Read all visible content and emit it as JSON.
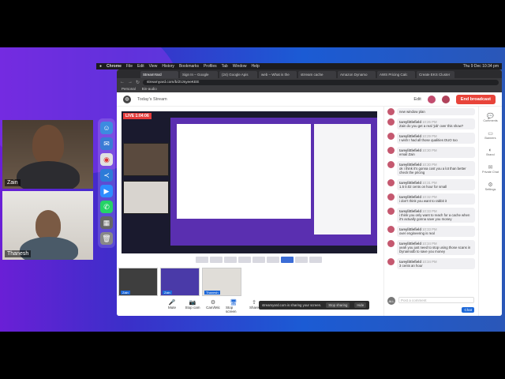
{
  "cams": [
    {
      "name": "Zain"
    },
    {
      "name": "Thanesh"
    }
  ],
  "menubar": {
    "apple": "",
    "items": [
      "Chrome",
      "File",
      "Edit",
      "View",
      "History",
      "Bookmarks",
      "Profiles",
      "Tab",
      "Window",
      "Help"
    ],
    "clock": "Thu 9 Dec 10:34 pm"
  },
  "browser": {
    "tabs": [
      "StreamYard",
      "Sign In – Google",
      "(24) Google Apis",
      "web – What is the",
      "strream cache",
      "Amazon Dynamo",
      "AWS Pricing Calc",
      "Create EKS Cluster"
    ],
    "url": "streamyard.com/b/ZrJsyeeKEE",
    "bookmarks": [
      "Personal",
      "Bin-audio"
    ]
  },
  "app": {
    "title": "Today's Stream",
    "edit_label": "Edit",
    "end_label": "End broadcast",
    "live_label": "LIVE 1:04:06"
  },
  "backstage": [
    {
      "name": "Zain"
    },
    {
      "name": "Zain"
    },
    {
      "name": "Thanesh"
    }
  ],
  "controls": [
    {
      "label": "Mute",
      "icon": "🎤"
    },
    {
      "label": "Stop cam",
      "icon": "📷"
    },
    {
      "label": "Cam/Mic",
      "icon": "⚙"
    },
    {
      "label": "Stop screen",
      "icon": "🖥"
    },
    {
      "label": "Share",
      "icon": "⇪"
    }
  ],
  "sharebar": {
    "text": "streamyard.com is sharing your screen.",
    "stop": "Stop sharing",
    "hide": "Hide"
  },
  "chat": {
    "messages": [
      {
        "user": "",
        "time": "",
        "text": "new window plan"
      },
      {
        "user": "tareylittlefield",
        "time": "10:26 PM",
        "text": "Zain do you get a real 'job' over this show?"
      },
      {
        "user": "tareylittlefield",
        "time": "10:29 PM",
        "text": "I wish I had all those qualities DUO too"
      },
      {
        "user": "tareylittlefield",
        "time": "10:30 PM",
        "text": "email Zain"
      },
      {
        "user": "tareylittlefield",
        "time": "10:30 PM",
        "text": "ok i think it's gonna cost you a lot than better check the pricing"
      },
      {
        "user": "tareylittlefield",
        "time": "10:31 PM",
        "text": "1.5 0.02 cents on hour for small"
      },
      {
        "user": "tareylittlefield",
        "time": "10:32 PM",
        "text": "i don't think you want to rabbit it"
      },
      {
        "user": "tareylittlefield",
        "time": "10:33 PM",
        "text": "i think you only want to reach for a cache when it's actually gonna save you money"
      },
      {
        "user": "tareylittlefield",
        "time": "10:33 PM",
        "text": "over engineering is real"
      },
      {
        "user": "tareylittlefield",
        "time": "10:34 PM",
        "text": "yeah you just need to stop using those scans in Dynamodb to save you money"
      },
      {
        "user": "tareylittlefield",
        "time": "10:34 PM",
        "text": "3 cents an hour"
      }
    ],
    "placeholder": "Post a comment",
    "send": "Chat",
    "avatar": "ALL"
  },
  "side": [
    {
      "label": "Comments",
      "icon": "💬"
    },
    {
      "label": "Banners",
      "icon": "▭"
    },
    {
      "label": "Brand",
      "icon": "◐"
    },
    {
      "label": "Private Chat",
      "icon": "✉"
    },
    {
      "label": "Settings",
      "icon": "⚙"
    }
  ]
}
